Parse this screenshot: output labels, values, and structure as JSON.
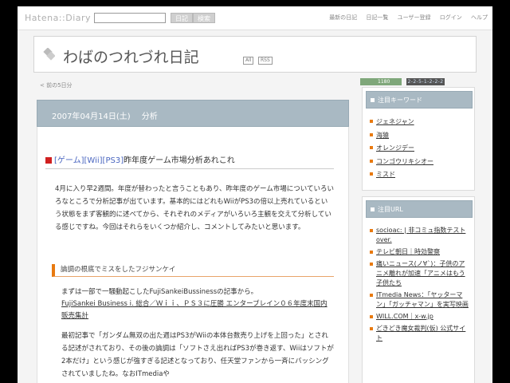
{
  "header": {
    "logo": "Hatena::Diary",
    "search_placeholder": "",
    "btn_diary": "日記",
    "btn_search": "検索",
    "links": [
      "最新の日記",
      "日記一覧",
      "ユーザー登録",
      "ログイン",
      "ヘルプ"
    ]
  },
  "diary": {
    "title": "わばのつれづれ日記",
    "badge_all": "All",
    "badge_rss": "RSS",
    "prev_link": "< 前の5日分"
  },
  "entry": {
    "date": "2007年04月14日(土)",
    "category": "分析",
    "tags": [
      "[ゲーム]",
      "[Wii]",
      "[PS3]"
    ],
    "title": "昨年度ゲーム市場分析あれこれ",
    "body": "4月に入り早2週間。年度が替わったと言うこともあり、昨年度のゲーム市場についていろいろなところで分析記事が出ています。基本的にはどれもWiiがPS3の倍以上売れているという状態をまず客観的に述べてから、それぞれのメディアがいろいろ主観を交えて分析している感じですね。今回はそれらをいくつか紹介し、コメントしてみたいと思います。",
    "section_heading": "論調の根底でミスをしたフジサンケイ",
    "intro": "まずは一部で一騒動起こしたFujiSankeiBussinessの記事から。",
    "article_link": "FujiSankei Business i. 総合／Ｗｉｉ、ＰＳ３に圧勝 エンターブレイン０６年度末国内販売集計",
    "body2": "最初記事で「ガンダム無双の出た週はPS3がWiiの本体台数売り上げを上回った」とされる記述がされており、その後の論調は「ソフトさえ出ればPS3が巻き返す、Wiiはソフトが2本だけ」という感じが強すぎる記述となっており、任天堂ファンから一斉にバッシングされていましたね。なおITmediaや"
  },
  "sidebar": {
    "counter": "1180",
    "clock": "2-2-5-1-2-2-2",
    "keywords_title": "注目キーワード",
    "keywords": [
      "ジェネジャン",
      "海猿",
      "オレンジデー",
      "コンゴウリキシオー",
      "ミスド"
    ],
    "urls_title": "注目URL",
    "urls": [
      "socioac: | 非コミュ指数テスト over.",
      "テレビ朝日｜時効警察",
      "痛いニュース(ノ∀`)：子供のアニメ離れが加速「アニメはもう子供たち",
      "ITmedia News：「ヤッターマン」「ガッチャマン」を実写映画",
      "WILL.COM｜x-w.jp",
      "どきどき魔女裁判(仮) 公式サイト"
    ]
  }
}
